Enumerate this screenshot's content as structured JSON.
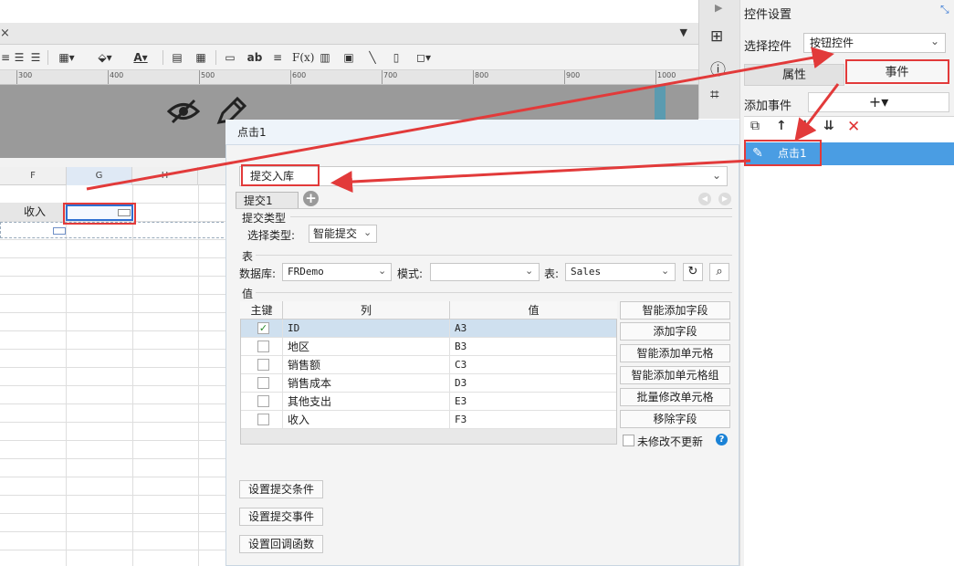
{
  "designer": {
    "tab_close": "×",
    "corner_glyph": "▼",
    "ruler_ticks": [
      "300",
      "400",
      "500",
      "600",
      "700",
      "800",
      "900",
      "1000"
    ],
    "columns": [
      "F",
      "G",
      "H"
    ],
    "cell_f": "收入"
  },
  "toolbar_icons": [
    "align-center-icon",
    "align-right-icon",
    "border-icon",
    "fill-color-icon",
    "font-color-icon",
    "merge-icon",
    "unmerge-icon",
    "text-field-icon",
    "ab-icon",
    "paragraph-icon",
    "formula-icon",
    "chart-icon",
    "image-icon",
    "slash-icon",
    "subreport-icon",
    "frame-icon"
  ],
  "side_strip_icons": [
    "collapse-arrow-icon",
    "layout-icon",
    "info-icon",
    "crop-icon"
  ],
  "right_panel": {
    "title": "控件设置",
    "select_control_label": "选择控件",
    "select_control_value": "按钮控件",
    "tab_attributes": "属性",
    "tab_events": "事件",
    "add_event_label": "添加事件",
    "add_event_btn": "+▾",
    "event_item": "点击1"
  },
  "dialog": {
    "title": "点击1",
    "type_value": "提交入库",
    "sub_tab": "提交1",
    "submit_type_section": "提交类型",
    "select_type_label": "选择类型:",
    "select_type_value": "智能提交",
    "table_section": "表",
    "db_label": "数据库:",
    "db_value": "FRDemo",
    "mode_label": "模式:",
    "mode_value": "",
    "table_label": "表:",
    "table_value": "Sales",
    "value_section": "值",
    "headers": [
      "主键",
      "列",
      "值"
    ],
    "rows": [
      {
        "key": true,
        "column": "ID",
        "value": "A3"
      },
      {
        "key": false,
        "column": "地区",
        "value": "B3"
      },
      {
        "key": false,
        "column": "销售额",
        "value": "C3"
      },
      {
        "key": false,
        "column": "销售成本",
        "value": "D3"
      },
      {
        "key": false,
        "column": "其他支出",
        "value": "E3"
      },
      {
        "key": false,
        "column": "收入",
        "value": "F3"
      }
    ],
    "side_buttons": [
      "智能添加字段",
      "添加字段",
      "智能添加单元格",
      "智能添加单元格组",
      "批量修改单元格",
      "移除字段"
    ],
    "no_update_label": "未修改不更新",
    "help": "?",
    "bottom_buttons": [
      "设置提交条件",
      "设置提交事件",
      "设置回调函数"
    ]
  },
  "colors": {
    "accent": "#4a9de3",
    "annotation": "#e23a3a",
    "selection": "#2f6fd1"
  }
}
